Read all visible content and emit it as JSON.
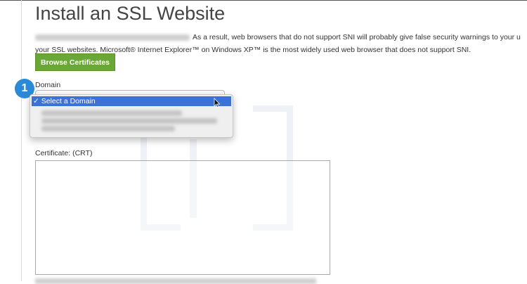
{
  "page": {
    "title": "Install an SSL Website",
    "description_text": "As a result, web browsers that do not support SNI will probably give false security warnings to your users when they visit your SSL websites. Microsoft® Internet Explorer™ on Windows XP™ is the most widely used web browser that does not support SNI.",
    "description_line1": "As a result, web browsers that do not support SNI will probably give false security warnings to your u",
    "description_line2": "your SSL websites. Microsoft® Internet Explorer™ on Windows XP™ is the most widely used web browser that does not support SNI."
  },
  "browse_button": {
    "label": "Browse Certificates"
  },
  "step_badge": {
    "number": "1"
  },
  "domain": {
    "label": "Domain",
    "selected_option": "✓ Select a Domain"
  },
  "certificate": {
    "label": "Certificate: (CRT)",
    "value": ""
  },
  "colors": {
    "accent_green": "#6aa737",
    "badge_blue": "#2a8ad8",
    "selection_blue": "#3a72d8"
  },
  "icons": {
    "cursor": "mouse-pointer-icon",
    "resize": "resize-grip-icon"
  }
}
